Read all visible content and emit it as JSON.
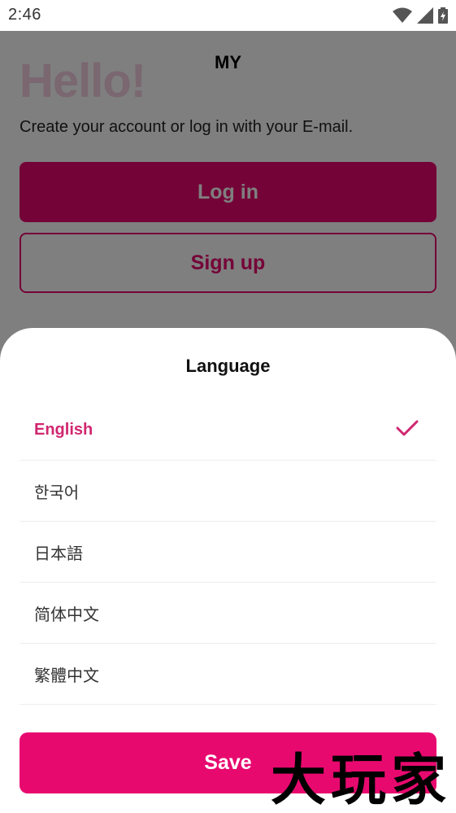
{
  "status_bar": {
    "time": "2:46",
    "icons": [
      "wifi-icon",
      "signal-icon",
      "battery-icon"
    ]
  },
  "app": {
    "title": "MY",
    "hello": "Hello!",
    "subtitle": "Create your account or log in with your E-mail.",
    "login_label": "Log in",
    "signup_label": "Sign up"
  },
  "sheet": {
    "title": "Language",
    "languages": [
      {
        "label": "English",
        "selected": true
      },
      {
        "label": "한국어",
        "selected": false
      },
      {
        "label": "日本語",
        "selected": false
      },
      {
        "label": "简体中文",
        "selected": false
      },
      {
        "label": "繁體中文",
        "selected": false
      }
    ],
    "save_label": "Save"
  },
  "watermark": "大玩家",
  "colors": {
    "accent": "#e8096f",
    "selected_text": "#d1266f",
    "scrim": "rgba(0,0,0,0.5)"
  }
}
